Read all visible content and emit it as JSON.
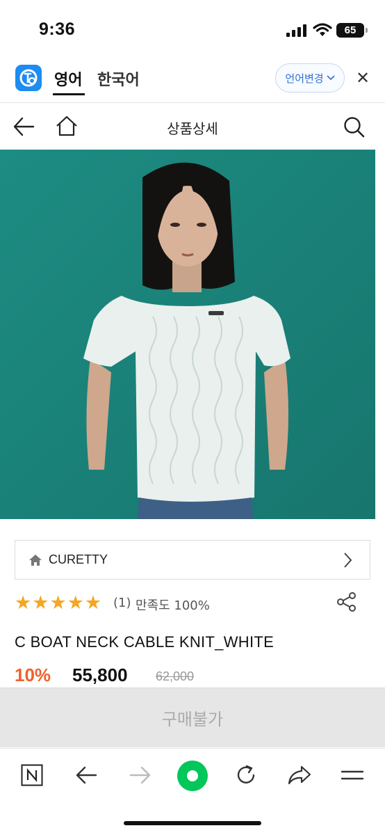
{
  "status_bar": {
    "time": "9:36",
    "battery": "65"
  },
  "translate_bar": {
    "tabs": [
      {
        "label": "영어",
        "active": true
      },
      {
        "label": "한국어",
        "active": false
      }
    ],
    "language_change_label": "언어변경",
    "close_symbol": "✕"
  },
  "header": {
    "title": "상품상세"
  },
  "brand": {
    "name": "CURETTY"
  },
  "rating": {
    "stars": 5,
    "count_text": "(1)",
    "satisfaction_text": "만족도 100%"
  },
  "product": {
    "title": "C BOAT NECK CABLE KNIT_WHITE",
    "discount": "10%",
    "price": "55,800",
    "original_price": "62,000"
  },
  "buy_button": {
    "label": "구매불가"
  },
  "toolbar": {
    "icons": [
      "naver-n-icon",
      "back-arrow-icon",
      "forward-arrow-icon",
      "green-dot-icon",
      "refresh-icon",
      "share-arrow-icon",
      "menu-icon"
    ]
  },
  "colors": {
    "accent": "#1e8cf0",
    "discount": "#f0602a",
    "star": "#f5a623",
    "green": "#03c75a",
    "image_bg": "#1f8a80"
  }
}
